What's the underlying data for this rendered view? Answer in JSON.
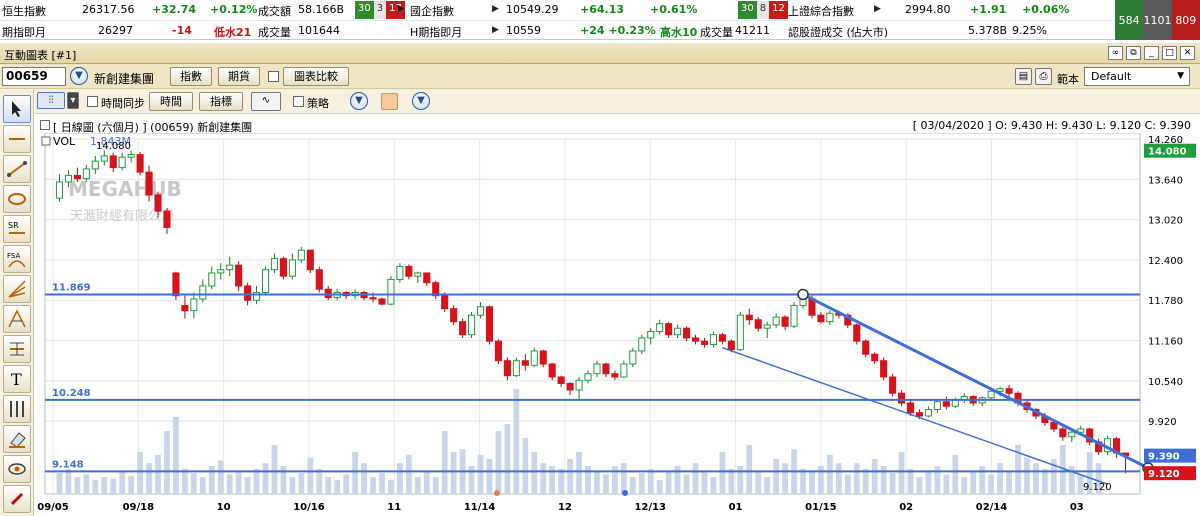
{
  "ticker": {
    "row1": [
      {
        "name": "恒生指數",
        "value": "26317.56",
        "change": "+32.74",
        "pct": "+0.12%",
        "turnover_label": "成交額",
        "turnover": "58.166B",
        "adv": "30",
        "unch": "3",
        "dec": "17"
      },
      {
        "name": "國企指數",
        "value": "10549.29",
        "change": "+64.13",
        "pct": "+0.61%",
        "adv": "30",
        "unch": "8",
        "dec": "12"
      },
      {
        "name": "上證綜合指數",
        "value": "2994.80",
        "change": "+1.91",
        "pct": "+0.06%"
      }
    ],
    "row2": [
      {
        "name": "期指即月",
        "value": "26297",
        "change": "-14",
        "note": "低水21",
        "vol_label": "成交量",
        "vol": "101644"
      },
      {
        "name": "H期指即月",
        "value": "10559",
        "change": "+24 +0.23%",
        "note": "高水10",
        "vol_label": "成交量",
        "vol": "41211"
      },
      {
        "name": "認股證成交 (佔大市)",
        "value": "5.378B",
        "pct": "9.25%"
      }
    ],
    "side": [
      "584",
      "1101",
      "809"
    ]
  },
  "window": {
    "title": "互動圖表 [#1]"
  },
  "toolbar": {
    "code": "00659",
    "name": "新創建集團",
    "btn_indices": "指數",
    "btn_futures": "期貨",
    "btn_compare": "圖表比較",
    "range_label": "範本",
    "range_value": "Default",
    "sync_label": "時間同步",
    "btn_time": "時間",
    "btn_indicator": "指標",
    "strategy_label": "策略"
  },
  "chart": {
    "title": "[ 日線圖 (六個月) ]  (00659)  新創建集團",
    "ohlc": "[ 03/04/2020 ]  O: 9.430  H: 9.430  L: 9.120  C: 9.390",
    "vol_label": "VOL",
    "vol_value": "1.843M",
    "watermark1": "MEGAHUB",
    "watermark2": "天滙財經有限公司",
    "marker_high": "14.080",
    "marker_low": "9.120"
  },
  "chart_data": {
    "type": "candlestick",
    "ylim": [
      8.8,
      14.26
    ],
    "y_ticks": [
      14.26,
      13.64,
      13.02,
      12.4,
      11.78,
      11.16,
      10.54,
      9.92
    ],
    "y_tick_labels": [
      "14.260",
      "13.640",
      "13.020",
      "12.400",
      "11.780",
      "11.160",
      "10.540",
      "9.920"
    ],
    "x_tick_labels": [
      "09/05",
      "09/18",
      "10",
      "10/16",
      "11",
      "11/14",
      "12",
      "12/13",
      "01",
      "01/15",
      "02",
      "02/14",
      "03"
    ],
    "horizontal_lines": [
      {
        "label": "11.869",
        "value": 11.869
      },
      {
        "label": "10.248",
        "value": 10.248
      },
      {
        "label": "9.148",
        "value": 9.148
      }
    ],
    "price_tags": [
      {
        "label": "14.080",
        "value": 14.08
      },
      {
        "label": "9.390",
        "value": 9.39
      },
      {
        "label": "9.120",
        "value": 9.12
      }
    ],
    "candles": [
      [
        13.35,
        13.72,
        13.3,
        13.6
      ],
      [
        13.6,
        13.78,
        13.52,
        13.7
      ],
      [
        13.7,
        13.82,
        13.6,
        13.65
      ],
      [
        13.65,
        13.86,
        13.6,
        13.8
      ],
      [
        13.8,
        14.0,
        13.72,
        13.92
      ],
      [
        13.92,
        14.08,
        13.85,
        14.0
      ],
      [
        14.0,
        14.05,
        13.75,
        13.82
      ],
      [
        13.82,
        14.05,
        13.78,
        13.98
      ],
      [
        13.98,
        14.08,
        13.9,
        14.02
      ],
      [
        14.02,
        14.06,
        13.7,
        13.75
      ],
      [
        13.75,
        13.85,
        13.3,
        13.4
      ],
      [
        13.4,
        13.45,
        13.05,
        13.15
      ],
      [
        13.15,
        13.2,
        12.8,
        12.9
      ],
      [
        12.2,
        12.22,
        11.78,
        11.85
      ],
      [
        11.7,
        11.85,
        11.5,
        11.62
      ],
      [
        11.62,
        11.9,
        11.5,
        11.8
      ],
      [
        11.8,
        12.1,
        11.75,
        12.0
      ],
      [
        12.0,
        12.3,
        11.95,
        12.2
      ],
      [
        12.2,
        12.35,
        12.1,
        12.25
      ],
      [
        12.25,
        12.45,
        12.15,
        12.32
      ],
      [
        12.32,
        12.38,
        11.92,
        12.0
      ],
      [
        12.0,
        12.05,
        11.7,
        11.78
      ],
      [
        11.78,
        12.0,
        11.72,
        11.9
      ],
      [
        11.9,
        12.3,
        11.85,
        12.25
      ],
      [
        12.25,
        12.5,
        12.2,
        12.42
      ],
      [
        12.42,
        12.45,
        12.1,
        12.15
      ],
      [
        12.15,
        12.5,
        12.1,
        12.4
      ],
      [
        12.4,
        12.6,
        12.35,
        12.55
      ],
      [
        12.55,
        12.56,
        12.2,
        12.25
      ],
      [
        12.25,
        12.3,
        11.9,
        11.95
      ],
      [
        11.95,
        12.0,
        11.78,
        11.82
      ],
      [
        11.82,
        11.95,
        11.78,
        11.9
      ],
      [
        11.9,
        11.92,
        11.8,
        11.85
      ],
      [
        11.85,
        11.95,
        11.8,
        11.9
      ],
      [
        11.9,
        11.92,
        11.78,
        11.82
      ],
      [
        11.82,
        11.9,
        11.75,
        11.8
      ],
      [
        11.8,
        11.82,
        11.7,
        11.72
      ],
      [
        11.72,
        12.15,
        11.7,
        12.1
      ],
      [
        12.1,
        12.35,
        12.05,
        12.3
      ],
      [
        12.3,
        12.33,
        12.1,
        12.15
      ],
      [
        12.15,
        12.22,
        12.05,
        12.2
      ],
      [
        12.2,
        12.2,
        12.0,
        12.05
      ],
      [
        12.05,
        12.08,
        11.8,
        11.85
      ],
      [
        11.85,
        11.9,
        11.6,
        11.65
      ],
      [
        11.65,
        11.7,
        11.4,
        11.45
      ],
      [
        11.45,
        11.5,
        11.2,
        11.25
      ],
      [
        11.25,
        11.6,
        11.2,
        11.55
      ],
      [
        11.55,
        11.75,
        11.5,
        11.68
      ],
      [
        11.68,
        11.7,
        11.1,
        11.15
      ],
      [
        11.15,
        11.18,
        10.8,
        10.85
      ],
      [
        10.85,
        10.9,
        10.55,
        10.62
      ],
      [
        10.62,
        10.9,
        10.6,
        10.85
      ],
      [
        10.85,
        10.95,
        10.7,
        10.78
      ],
      [
        10.78,
        11.05,
        10.75,
        11.0
      ],
      [
        11.0,
        11.02,
        10.75,
        10.8
      ],
      [
        10.8,
        10.82,
        10.55,
        10.6
      ],
      [
        10.6,
        10.62,
        10.45,
        10.5
      ],
      [
        10.5,
        10.52,
        10.32,
        10.4
      ],
      [
        10.4,
        10.6,
        10.25,
        10.55
      ],
      [
        10.55,
        10.7,
        10.5,
        10.65
      ],
      [
        10.65,
        10.85,
        10.6,
        10.8
      ],
      [
        10.8,
        10.82,
        10.6,
        10.65
      ],
      [
        10.65,
        10.7,
        10.55,
        10.6
      ],
      [
        10.6,
        10.85,
        10.58,
        10.8
      ],
      [
        10.8,
        11.05,
        10.75,
        11.0
      ],
      [
        11.0,
        11.25,
        10.95,
        11.2
      ],
      [
        11.2,
        11.35,
        11.1,
        11.3
      ],
      [
        11.3,
        11.48,
        11.25,
        11.42
      ],
      [
        11.42,
        11.45,
        11.2,
        11.25
      ],
      [
        11.25,
        11.4,
        11.2,
        11.35
      ],
      [
        11.35,
        11.38,
        11.15,
        11.2
      ],
      [
        11.2,
        11.25,
        11.1,
        11.15
      ],
      [
        11.15,
        11.2,
        11.05,
        11.1
      ],
      [
        11.1,
        11.3,
        11.05,
        11.25
      ],
      [
        11.25,
        11.28,
        11.1,
        11.15
      ],
      [
        11.15,
        11.18,
        10.98,
        11.02
      ],
      [
        11.02,
        11.6,
        11.0,
        11.55
      ],
      [
        11.55,
        11.65,
        11.4,
        11.48
      ],
      [
        11.48,
        11.52,
        11.3,
        11.35
      ],
      [
        11.35,
        11.45,
        11.2,
        11.4
      ],
      [
        11.4,
        11.58,
        11.35,
        11.52
      ],
      [
        11.52,
        11.55,
        11.32,
        11.38
      ],
      [
        11.38,
        11.75,
        11.35,
        11.7
      ],
      [
        11.7,
        11.87,
        11.65,
        11.8
      ],
      [
        11.8,
        11.85,
        11.5,
        11.55
      ],
      [
        11.55,
        11.6,
        11.42,
        11.45
      ],
      [
        11.45,
        11.62,
        11.4,
        11.58
      ],
      [
        11.58,
        11.62,
        11.5,
        11.55
      ],
      [
        11.55,
        11.58,
        11.35,
        11.4
      ],
      [
        11.4,
        11.42,
        11.1,
        11.15
      ],
      [
        11.15,
        11.18,
        10.9,
        10.95
      ],
      [
        10.95,
        10.98,
        10.8,
        10.85
      ],
      [
        10.85,
        10.9,
        10.55,
        10.6
      ],
      [
        10.6,
        10.65,
        10.3,
        10.35
      ],
      [
        10.35,
        10.4,
        10.15,
        10.2
      ],
      [
        10.2,
        10.25,
        10.0,
        10.05
      ],
      [
        10.05,
        10.1,
        9.95,
        10.0
      ],
      [
        10.0,
        10.15,
        9.98,
        10.1
      ],
      [
        10.1,
        10.25,
        10.05,
        10.22
      ],
      [
        10.22,
        10.3,
        10.1,
        10.15
      ],
      [
        10.15,
        10.28,
        10.12,
        10.25
      ],
      [
        10.25,
        10.35,
        10.2,
        10.3
      ],
      [
        10.3,
        10.32,
        10.15,
        10.2
      ],
      [
        10.2,
        10.3,
        10.15,
        10.28
      ],
      [
        10.28,
        10.4,
        10.25,
        10.38
      ],
      [
        10.38,
        10.45,
        10.3,
        10.42
      ],
      [
        10.42,
        10.48,
        10.3,
        10.35
      ],
      [
        10.35,
        10.38,
        10.15,
        10.2
      ],
      [
        10.2,
        10.25,
        10.05,
        10.1
      ],
      [
        10.1,
        10.12,
        9.95,
        10.0
      ],
      [
        10.0,
        10.05,
        9.85,
        9.9
      ],
      [
        9.9,
        9.95,
        9.75,
        9.8
      ],
      [
        9.8,
        9.85,
        9.62,
        9.68
      ],
      [
        9.68,
        9.78,
        9.6,
        9.75
      ],
      [
        9.75,
        9.85,
        9.7,
        9.8
      ],
      [
        9.8,
        9.82,
        9.55,
        9.6
      ],
      [
        9.6,
        9.65,
        9.4,
        9.45
      ],
      [
        9.45,
        9.7,
        9.4,
        9.65
      ],
      [
        9.65,
        9.68,
        9.35,
        9.43
      ],
      [
        9.43,
        9.43,
        9.12,
        9.39
      ]
    ],
    "volumes": [
      0.15,
      0.18,
      0.12,
      0.14,
      0.1,
      0.12,
      0.11,
      0.16,
      0.13,
      0.3,
      0.22,
      0.28,
      0.45,
      0.55,
      0.18,
      0.15,
      0.12,
      0.2,
      0.24,
      0.14,
      0.16,
      0.12,
      0.18,
      0.22,
      0.35,
      0.2,
      0.12,
      0.15,
      0.26,
      0.18,
      0.12,
      0.1,
      0.14,
      0.3,
      0.22,
      0.12,
      0.15,
      0.1,
      0.22,
      0.28,
      0.12,
      0.16,
      0.12,
      0.45,
      0.3,
      0.32,
      0.2,
      0.28,
      0.25,
      0.45,
      0.5,
      0.75,
      0.4,
      0.3,
      0.22,
      0.2,
      0.18,
      0.25,
      0.3,
      0.2,
      0.16,
      0.14,
      0.2,
      0.22,
      0.12,
      0.15,
      0.18,
      0.1,
      0.16,
      0.2,
      0.14,
      0.22,
      0.16,
      0.12,
      0.3,
      0.18,
      0.2,
      0.35,
      0.16,
      0.12,
      0.25,
      0.22,
      0.32,
      0.18,
      0.16,
      0.2,
      0.28,
      0.22,
      0.14,
      0.22,
      0.18,
      0.25,
      0.2,
      0.15,
      0.3,
      0.18,
      0.12,
      0.16,
      0.2,
      0.14,
      0.28,
      0.12,
      0.16,
      0.2,
      0.14,
      0.22,
      0.16,
      0.35,
      0.26,
      0.22,
      0.18,
      0.25,
      0.35,
      0.2,
      0.14,
      0.3,
      0.22
    ]
  }
}
